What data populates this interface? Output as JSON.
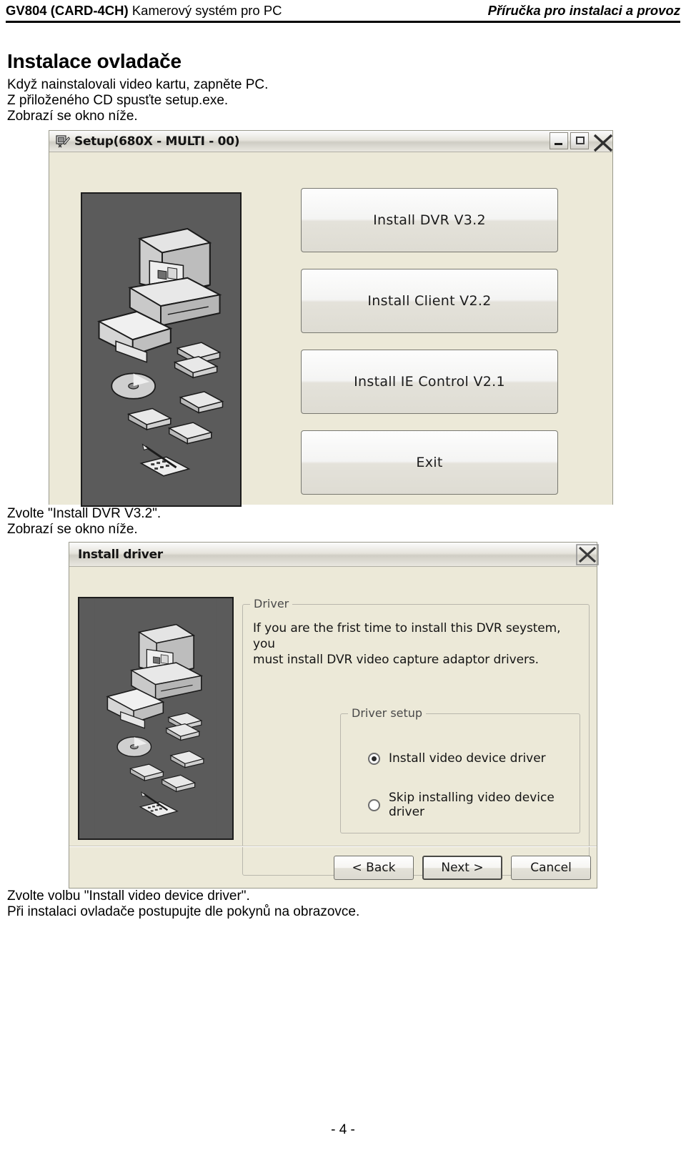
{
  "header": {
    "product_code": "GV804 (CARD-4CH)",
    "product_name": "Kamerový systém pro PC",
    "manual_title": "Příručka pro instalaci a provoz"
  },
  "document": {
    "heading": "Instalace ovladače",
    "intro_paragraph": "Když nainstalovali video kartu, zapněte PC.\nZ přiloženého CD spusťte setup.exe.\nZobrazí se okno níže.",
    "middle_paragraph": "Zvolte \"Install DVR V3.2\".\nZobrazí se okno níže.",
    "end_paragraph": "Zvolte volbu \"Install video device driver\".\nPři instalaci ovladače postupujte dle pokynů na obrazovce.",
    "page_number": "- 4 -"
  },
  "setup_dialog": {
    "title": "Setup(680X - MULTI - 00)",
    "title_icon": "setup-app-icon",
    "illustration": "pc-hardware-components-illustration",
    "caption_buttons": [
      {
        "name": "minimize-button",
        "icon": "minimize-icon"
      },
      {
        "name": "maximize-button",
        "icon": "maximize-icon"
      },
      {
        "name": "close-button",
        "icon": "close-icon"
      }
    ],
    "buttons": [
      {
        "id": "install-dvr",
        "label": "Install DVR V3.2"
      },
      {
        "id": "install-client",
        "label": "Install Client V2.2"
      },
      {
        "id": "install-ie-control",
        "label": "Install IE Control V2.1"
      },
      {
        "id": "exit",
        "label": "Exit"
      }
    ]
  },
  "driver_dialog": {
    "title": "Install driver",
    "illustration": "pc-hardware-components-illustration",
    "caption_buttons": [
      {
        "name": "close-button",
        "icon": "close-icon"
      }
    ],
    "driver_group": {
      "legend": "Driver",
      "description": "If you are the frist time to install this DVR seystem, you\nmust install  DVR  video capture adaptor  drivers."
    },
    "driver_setup_group": {
      "legend": "Driver setup",
      "options": [
        {
          "id": "install-video-device-driver",
          "label": "Install video device driver",
          "selected": true
        },
        {
          "id": "skip-installing-video-device-driver",
          "label": "Skip installing video device driver",
          "selected": false
        }
      ]
    },
    "footer_buttons": [
      {
        "id": "back",
        "label": "< Back",
        "default": false
      },
      {
        "id": "next",
        "label": "Next >",
        "default": true
      },
      {
        "id": "cancel",
        "label": "Cancel",
        "default": false
      }
    ]
  },
  "colors": {
    "dialog_face": "#ece9d8",
    "art_background": "#5b5b5b",
    "page_background": "#ffffff",
    "text": "#000000"
  }
}
